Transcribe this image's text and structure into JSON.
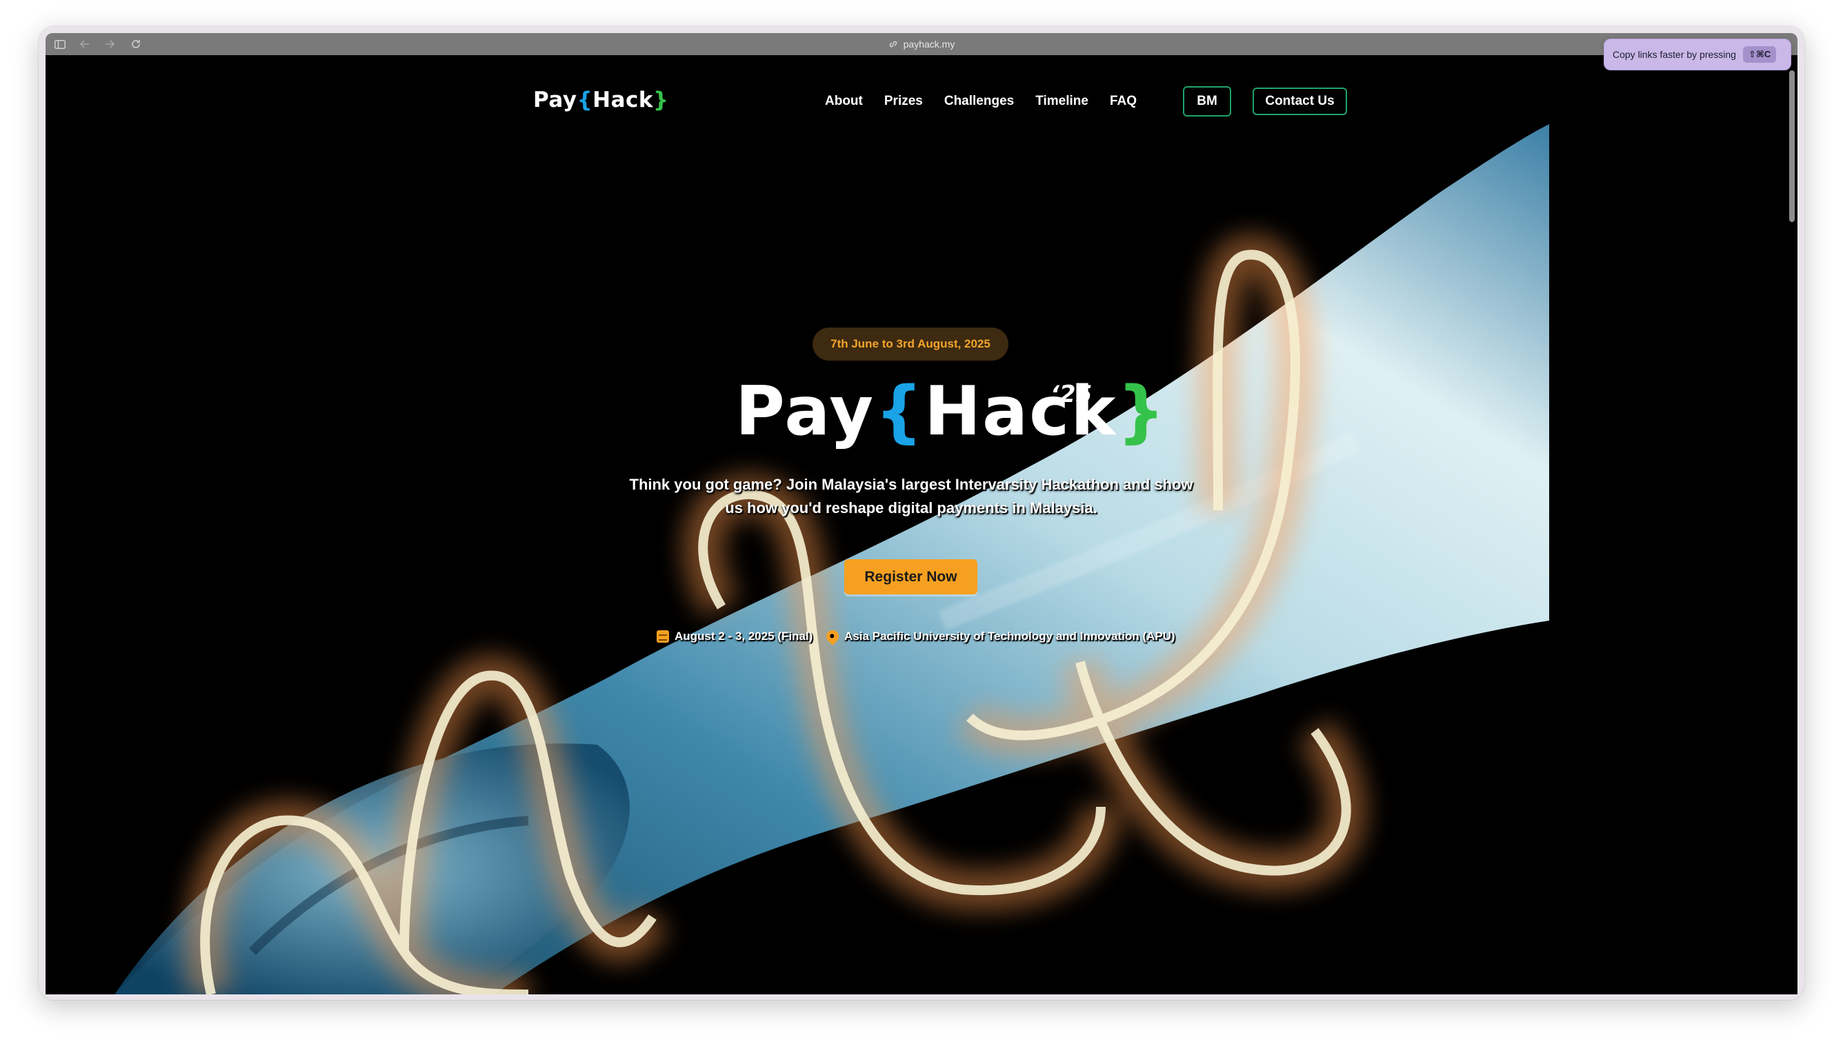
{
  "browser": {
    "url": "payhack.my",
    "icons": [
      "sidebar-icon",
      "back-icon",
      "forward-icon",
      "reload-icon",
      "link-icon"
    ]
  },
  "nav": {
    "logo": {
      "pre": "Pay",
      "open": "{",
      "mid": "Hack",
      "close": "}"
    },
    "links": [
      "About",
      "Prizes",
      "Challenges",
      "Timeline",
      "FAQ"
    ],
    "lang_button": "BM",
    "contact_button": "Contact Us"
  },
  "hero": {
    "date_pill": "7th June to 3rd August, 2025",
    "logo": {
      "pre": "Pay",
      "open": "{",
      "mid": "Hack",
      "close": "}"
    },
    "year": "‘25",
    "tagline": "Think you got game? Join Malaysia's largest Intervarsity Hackathon and show us how you'd reshape digital payments in Malaysia.",
    "cta": "Register Now",
    "event_date": "August 2 - 3, 2025 (Final)",
    "venue": "Asia Pacific University of Technology and Innovation (APU)"
  },
  "toast": {
    "text": "Copy links faster by pressing",
    "shortcut": "⇧⌘C"
  },
  "colors": {
    "accent_orange": "#f5a020",
    "brace_blue": "#1aa3e6",
    "brace_green": "#35c24a",
    "nav_outline": "#1fa36b"
  }
}
